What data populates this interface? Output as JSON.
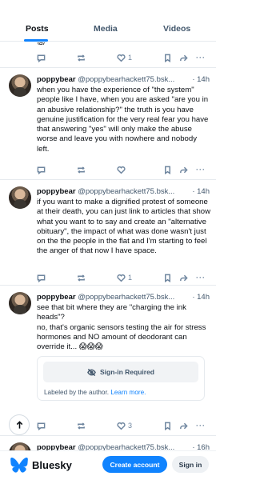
{
  "tabs": [
    {
      "label": "Posts",
      "active": true
    },
    {
      "label": "Media",
      "active": false
    },
    {
      "label": "Videos",
      "active": false
    }
  ],
  "previous_post": {
    "partial_emoji": "😱",
    "like_count": "1"
  },
  "posts": [
    {
      "author": "poppybear",
      "handle": "@poppybearhackett75.bsk...",
      "time": "14h",
      "text": "when you have the experience of \"the system\" people like I have, when you are asked \"are you in an abusive relationship?\" the truth is you have genuine justification for the very real fear you have that answering \"yes\" will only make the abuse worse and leave you with nowhere and nobody left.",
      "like_count": ""
    },
    {
      "author": "poppybear",
      "handle": "@poppybearhackett75.bsk...",
      "time": "14h",
      "text": "if you want to make a dignified protest of someone at their death, you can just link to articles that show what you want to to say and create an \"alternative obituary\", the impact of what was done wasn't just on the the people in the flat and I'm starting to feel the anger of that now I have space.",
      "like_count": "1"
    },
    {
      "author": "poppybear",
      "handle": "@poppybearhackett75.bsk...",
      "time": "14h",
      "text": "see that bit where they are \"charging the ink heads\"?\nno, that's organic sensors testing the air for stress hormones and NO amount of deodorant can override it... 😱😱😱",
      "like_count": "3",
      "label": {
        "sign_in_text": "Sign-in Required",
        "labeled_by": "Labeled by the author.",
        "learn_more": "Learn more."
      }
    },
    {
      "author": "poppybear",
      "handle": "@poppybearhackett75.bsk...",
      "time": "16h"
    }
  ],
  "bottom_bar": {
    "brand": "Bluesky",
    "create_account": "Create account",
    "sign_in": "Sign in"
  },
  "colors": {
    "accent": "#1083fe",
    "muted": "#42576c",
    "icon": "#6f869f",
    "border": "#e6eaee"
  },
  "icons": [
    "reply-icon",
    "repost-icon",
    "like-icon",
    "bookmark-icon",
    "share-icon",
    "eye-slash-icon",
    "arrow-up-icon",
    "butterfly-logo-icon"
  ]
}
